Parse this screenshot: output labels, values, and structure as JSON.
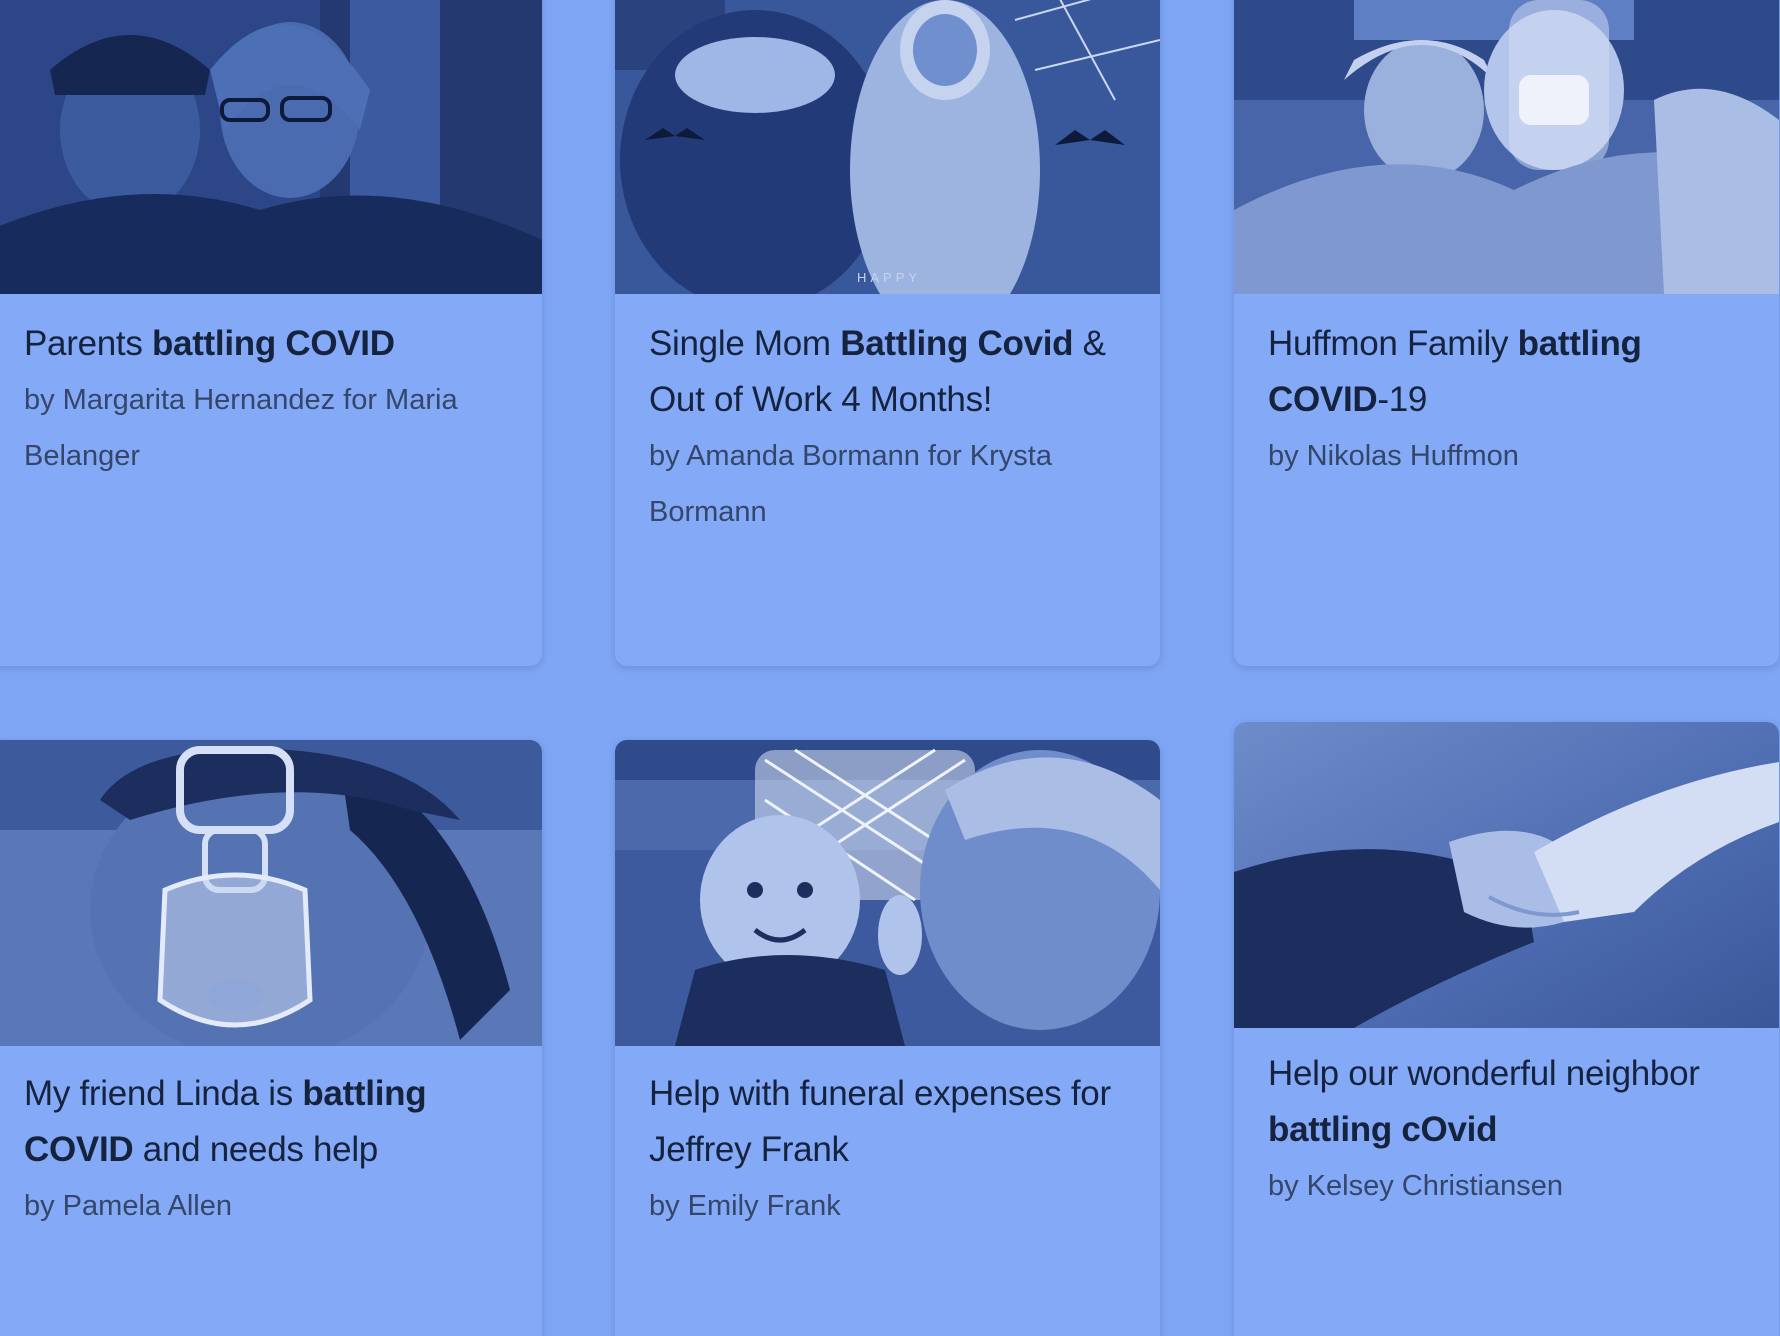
{
  "colors": {
    "page_background": "#7fa6f4",
    "card_background": "#84aaf7",
    "title_text": "#15233f",
    "author_text": "#34466a",
    "image_tint": "#2f4f9a"
  },
  "cards": [
    {
      "title_parts": [
        {
          "text": "Parents "
        },
        {
          "text": "battling COVID",
          "bold": true
        }
      ],
      "author": "by Margarita Hernandez for Maria Belanger",
      "image": "photo-couple-icon"
    },
    {
      "title_parts": [
        {
          "text": "Single Mom "
        },
        {
          "text": "Battling Covid",
          "bold": true
        },
        {
          "text": " & Out of Work 4 Months!"
        }
      ],
      "author": "by Amanda Bormann for Krysta Bormann",
      "image": "photo-halloween-icon",
      "image_caption": "HAPPY"
    },
    {
      "title_parts": [
        {
          "text": "Huffmon Family "
        },
        {
          "text": "battling COVID",
          "bold": true
        },
        {
          "text": "-19"
        }
      ],
      "author": "by Nikolas Huffmon",
      "image": "photo-hospital-icon"
    },
    {
      "title_parts": [
        {
          "text": "My friend Linda is "
        },
        {
          "text": "battling COVID",
          "bold": true
        },
        {
          "text": " and needs help"
        }
      ],
      "author": "by Pamela Allen",
      "image": "photo-oxygen-mask-icon"
    },
    {
      "title_parts": [
        {
          "text": "Help with funeral expenses for Jeffrey Frank"
        }
      ],
      "author": "by Emily Frank",
      "image": "photo-baby-grandfather-icon"
    },
    {
      "title_parts": [
        {
          "text": "Help our wonderful neighbor "
        },
        {
          "text": "battling cOvid",
          "bold": true
        }
      ],
      "author": "by Kelsey Christiansen",
      "image": "photo-holding-hands-icon"
    }
  ]
}
